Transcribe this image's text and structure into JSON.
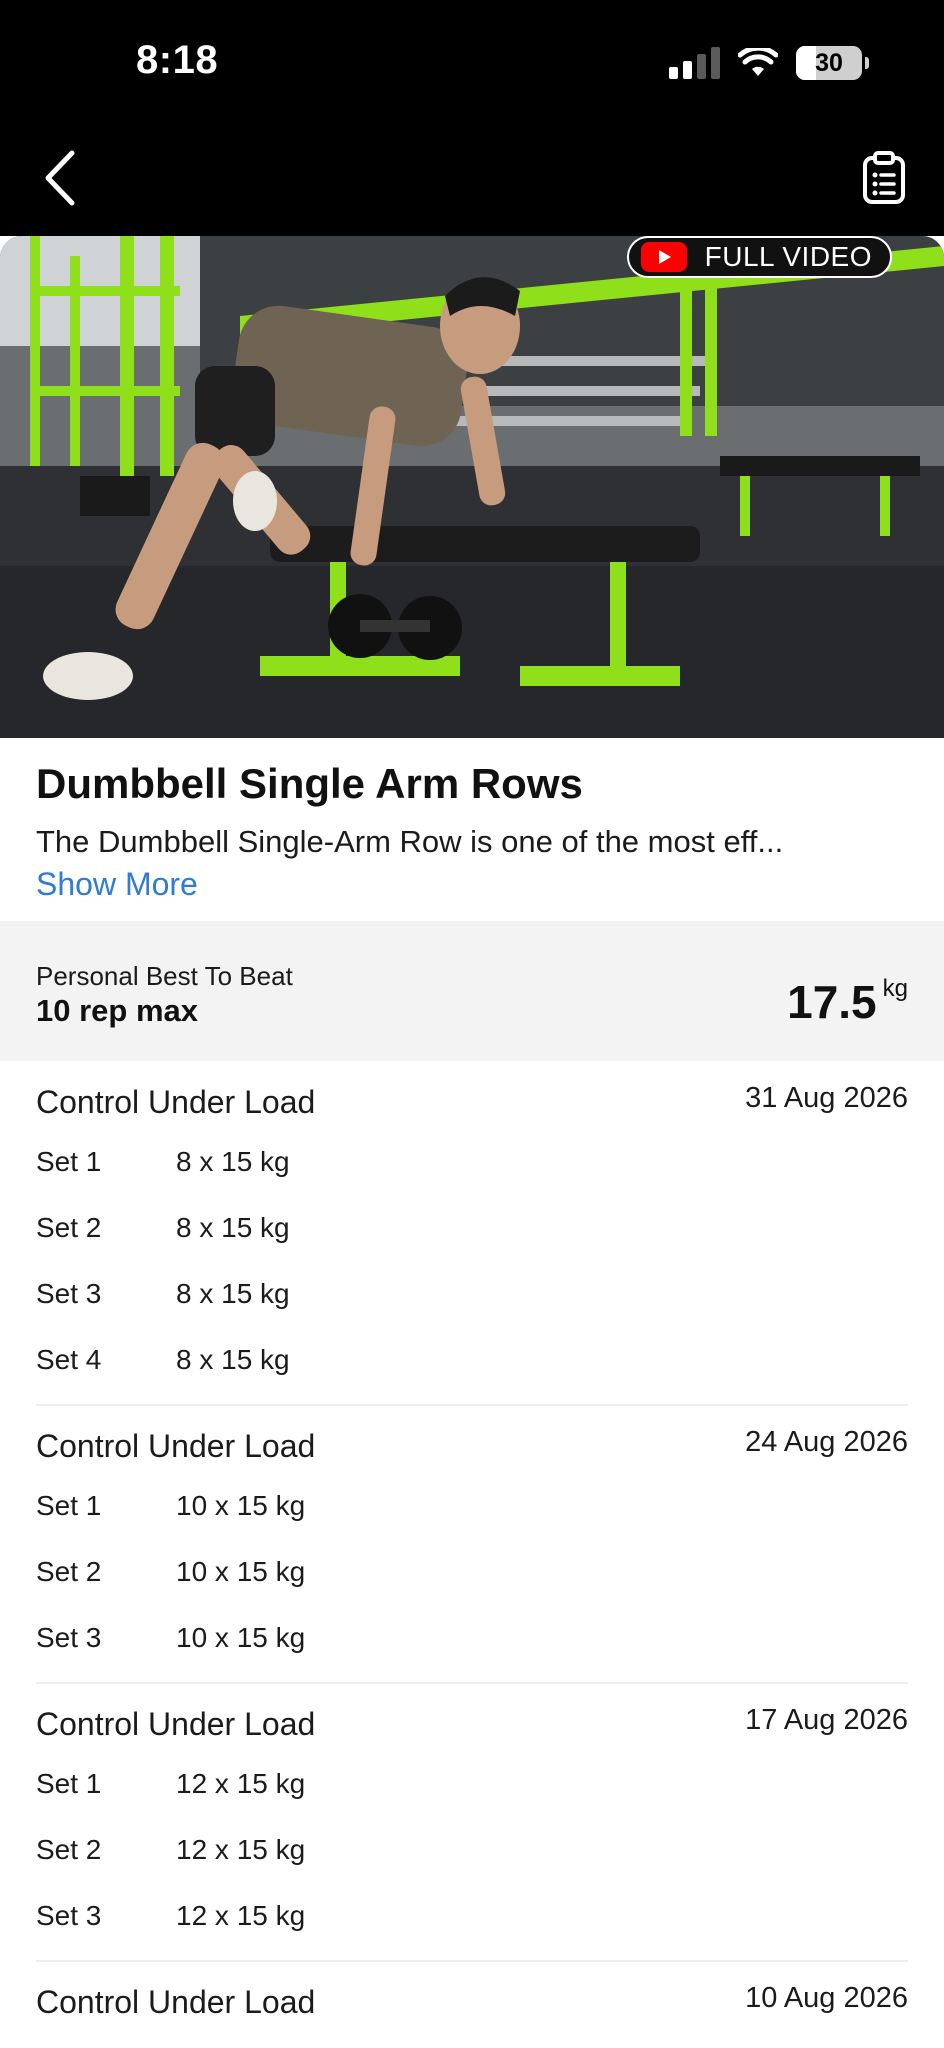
{
  "status_bar": {
    "time": "8:18",
    "battery": "30",
    "battery_level": 0.3
  },
  "header": {
    "back_icon": "chevron-left-icon",
    "clipboard_icon": "clipboard-list-icon"
  },
  "video": {
    "badge_label": "FULL VIDEO",
    "badge_icon": "youtube-play-icon"
  },
  "exercise": {
    "title": "Dumbbell Single Arm Rows",
    "description": "The Dumbbell Single-Arm Row is one of the most eff...",
    "show_more": "Show More"
  },
  "personal_best": {
    "label": "Personal Best To Beat",
    "sub": "10 rep max",
    "value": "17.5",
    "unit": "kg"
  },
  "sessions": [
    {
      "name": "Control Under Load",
      "date": "31 Aug 2026",
      "sets": [
        {
          "label": "Set 1",
          "value": "8 x 15 kg"
        },
        {
          "label": "Set 2",
          "value": "8 x 15 kg"
        },
        {
          "label": "Set 3",
          "value": "8 x 15 kg"
        },
        {
          "label": "Set 4",
          "value": "8 x 15 kg"
        }
      ]
    },
    {
      "name": "Control Under Load",
      "date": "24 Aug 2026",
      "sets": [
        {
          "label": "Set 1",
          "value": "10 x 15 kg"
        },
        {
          "label": "Set 2",
          "value": "10 x 15 kg"
        },
        {
          "label": "Set 3",
          "value": "10 x 15 kg"
        }
      ]
    },
    {
      "name": "Control Under Load",
      "date": "17 Aug 2026",
      "sets": [
        {
          "label": "Set 1",
          "value": "12 x 15 kg"
        },
        {
          "label": "Set 2",
          "value": "12 x 15 kg"
        },
        {
          "label": "Set 3",
          "value": "12 x 15 kg"
        }
      ]
    },
    {
      "name": "Control Under Load",
      "date": "10 Aug 2026",
      "sets": []
    }
  ],
  "colors": {
    "accent_link": "#2f7bd6",
    "youtube_red": "#ff0000",
    "gym_green": "#8fe01a"
  }
}
